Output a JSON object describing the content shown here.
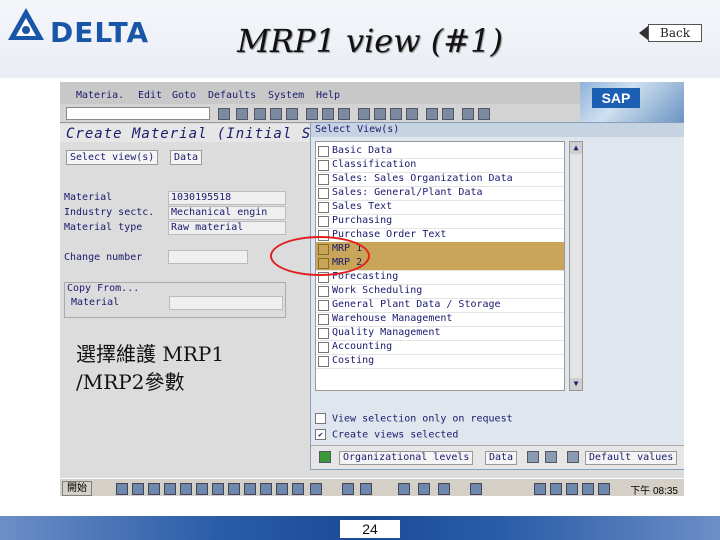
{
  "slide": {
    "logo_text": "DELTA",
    "title": "MRP1 view (#1)",
    "back_label": "Back",
    "caption_line1": "選擇維護 MRP1",
    "caption_line2": "/MRP2參數",
    "page_number": "24"
  },
  "sap": {
    "menu": [
      "Materia.",
      "Edit",
      "Goto",
      "Defaults",
      "System",
      "Help"
    ],
    "logo": "SAP",
    "screen_title": "Create Material (Initial S",
    "buttons": [
      "Select view(s)",
      "Data"
    ],
    "fields": {
      "material_label": "Material",
      "material_value": "1030195518",
      "industry_label": "Industry sectc.",
      "industry_value": "Mechanical engin",
      "type_label": "Material type",
      "type_value": "Raw material",
      "change_label": "Change number",
      "change_value": ""
    },
    "copy_from": {
      "title": "Copy From...",
      "material_label": "Material"
    },
    "dialog": {
      "title": "Select View(s)",
      "views": [
        {
          "label": "Basic Data",
          "selected": false
        },
        {
          "label": "Classification",
          "selected": false
        },
        {
          "label": "Sales: Sales Organization Data",
          "selected": false
        },
        {
          "label": "Sales: General/Plant Data",
          "selected": false
        },
        {
          "label": "Sales Text",
          "selected": false
        },
        {
          "label": "Purchasing",
          "selected": false
        },
        {
          "label": "Purchase Order Text",
          "selected": false
        },
        {
          "label": "MRP 1",
          "selected": true
        },
        {
          "label": "MRP 2",
          "selected": true
        },
        {
          "label": "Forecasting",
          "selected": false
        },
        {
          "label": "Work Scheduling",
          "selected": false
        },
        {
          "label": "General Plant Data / Storage",
          "selected": false
        },
        {
          "label": "Warehouse Management",
          "selected": false
        },
        {
          "label": "Quality Management",
          "selected": false
        },
        {
          "label": "Accounting",
          "selected": false
        },
        {
          "label": "Costing",
          "selected": false
        }
      ],
      "option1": "View selection only on request",
      "option2": "Create views selected",
      "btn_org": "Organizational levels",
      "btn_data": "Data",
      "btn_defaults": "Default values"
    },
    "taskbar": {
      "start": "開始",
      "clock": "下午 08:35"
    },
    "colors": {
      "selected_row": "#c9a55a",
      "annotation": "#e02020"
    }
  }
}
